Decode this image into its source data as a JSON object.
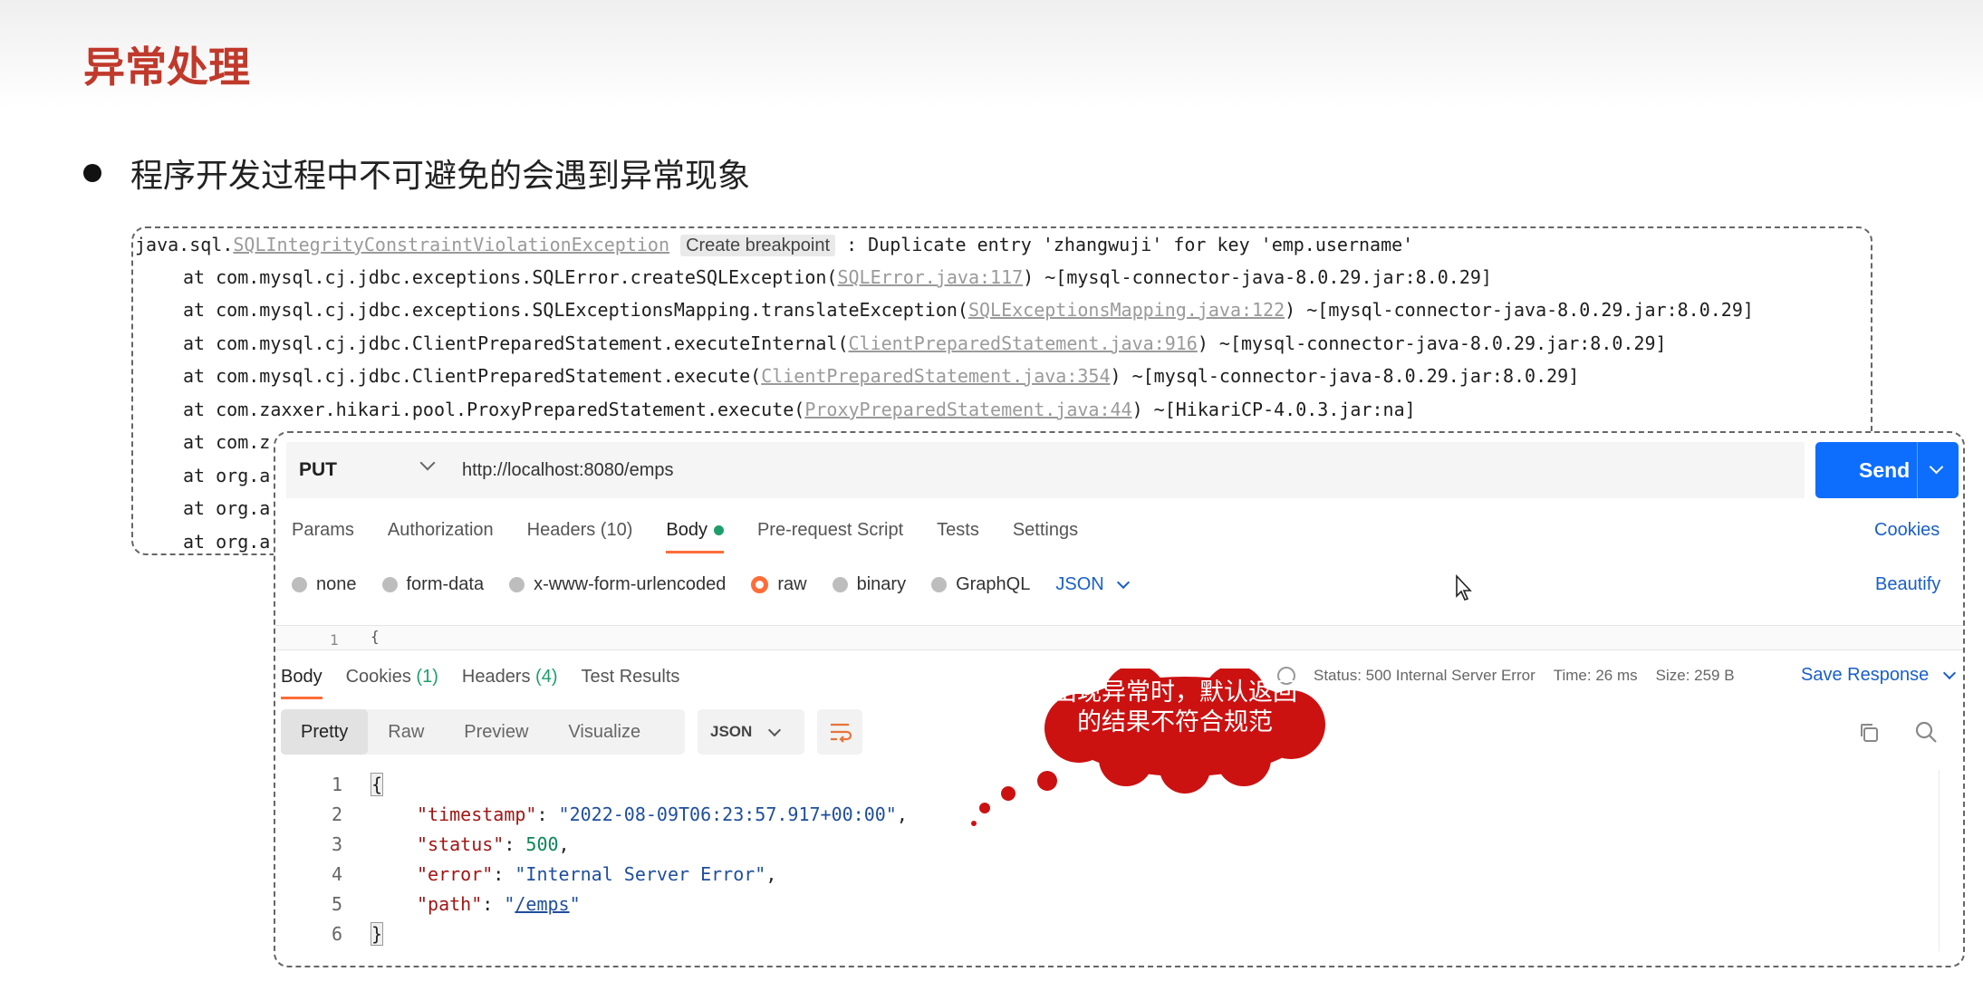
{
  "slide": {
    "title": "异常处理",
    "bullet": "程序开发过程中不可避免的会遇到异常现象"
  },
  "trace": {
    "first_prefix": "java.sql.",
    "exception_class": "SQLIntegrityConstraintViolationException",
    "breakpoint_label": "Create breakpoint",
    "message": " : Duplicate entry 'zhangwuji' for key 'emp.username'",
    "lines": [
      {
        "at": "at com.mysql.cj.jdbc.exceptions.SQLError.createSQLException(",
        "link": "SQLError.java:117",
        "tail": ") ~[mysql-connector-java-8.0.29.jar:8.0.29]"
      },
      {
        "at": "at com.mysql.cj.jdbc.exceptions.SQLExceptionsMapping.translateException(",
        "link": "SQLExceptionsMapping.java:122",
        "tail": ") ~[mysql-connector-java-8.0.29.jar:8.0.29]"
      },
      {
        "at": "at com.mysql.cj.jdbc.ClientPreparedStatement.executeInternal(",
        "link": "ClientPreparedStatement.java:916",
        "tail": ") ~[mysql-connector-java-8.0.29.jar:8.0.29]"
      },
      {
        "at": "at com.mysql.cj.jdbc.ClientPreparedStatement.execute(",
        "link": "ClientPreparedStatement.java:354",
        "tail": ") ~[mysql-connector-java-8.0.29.jar:8.0.29]"
      },
      {
        "at": "at com.zaxxer.hikari.pool.ProxyPreparedStatement.execute(",
        "link": "ProxyPreparedStatement.java:44",
        "tail": ") ~[HikariCP-4.0.3.jar:na]"
      },
      {
        "at": "at com.z",
        "link": "",
        "tail": ""
      },
      {
        "at": "at org.a",
        "link": "",
        "tail": ""
      },
      {
        "at": "at org.a",
        "link": "",
        "tail": ""
      },
      {
        "at": "at org.a",
        "link": "",
        "tail": ""
      }
    ]
  },
  "request": {
    "method": "PUT",
    "url": "http://localhost:8080/emps",
    "send_label": "Send",
    "tabs": {
      "params": "Params",
      "authorization": "Authorization",
      "headers": "Headers (10)",
      "body": "Body",
      "prerequest": "Pre-request Script",
      "tests": "Tests",
      "settings": "Settings"
    },
    "cookies_label": "Cookies",
    "body_types": {
      "none": "none",
      "form_data": "form-data",
      "urlencoded": "x-www-form-urlencoded",
      "raw": "raw",
      "binary": "binary",
      "graphql": "GraphQL"
    },
    "format": "JSON",
    "beautify_label": "Beautify",
    "editor_line": "1",
    "editor_text": "{"
  },
  "response": {
    "tabs": {
      "body": "Body",
      "cookies": "Cookies",
      "cookies_count": "(1)",
      "headers": "Headers",
      "headers_count": "(4)",
      "test_results": "Test Results"
    },
    "status": "Status: 500 Internal Server Error",
    "time": "Time: 26 ms",
    "size": "Size: 259 B",
    "save_label": "Save Response",
    "views": {
      "pretty": "Pretty",
      "raw": "Raw",
      "preview": "Preview",
      "visualize": "Visualize"
    },
    "format": "JSON",
    "code": {
      "open": "{",
      "close": "}",
      "timestamp_key": "\"timestamp\"",
      "timestamp_val": "\"2022-08-09T06:23:57.917+00:00\"",
      "status_key": "\"status\"",
      "status_val": "500",
      "error_key": "\"error\"",
      "error_val": "\"Internal Server Error\"",
      "path_key": "\"path\"",
      "path_val": "/emps"
    },
    "line_numbers": [
      "1",
      "2",
      "3",
      "4",
      "5",
      "6"
    ]
  },
  "callout": {
    "text": "出现异常时，默认返回的结果不符合规范",
    "color": "#cc1111"
  },
  "colors": {
    "title": "#c0392b",
    "send": "#0d6efd",
    "accent_tab": "#ff6c37",
    "link": "#1a5fc8"
  }
}
